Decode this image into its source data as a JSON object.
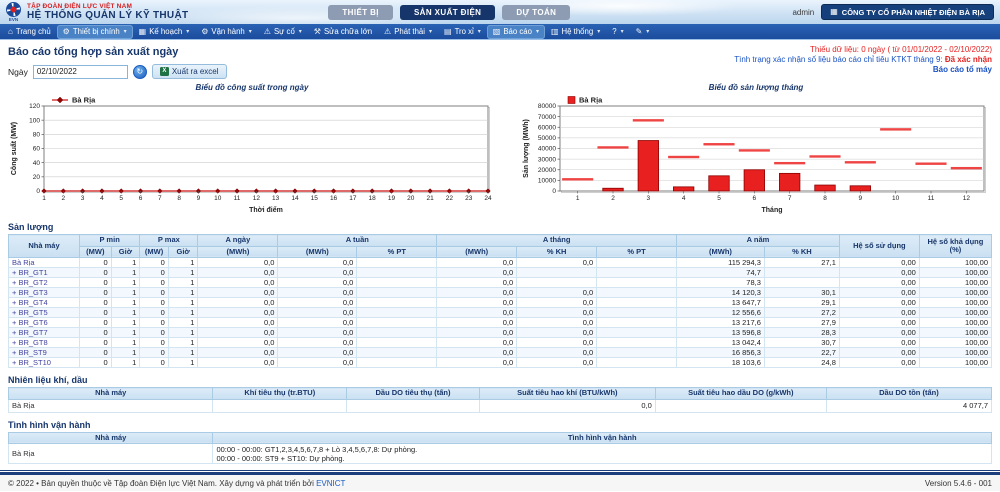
{
  "header": {
    "org": "TẬP ĐOÀN ĐIỆN LỰC VIỆT NAM",
    "system": "HỆ THỐNG QUẢN LÝ KỸ THUẬT",
    "logo_text": "EVN",
    "modules": [
      {
        "key": "thiet-bi",
        "label": "THIẾT BỊ",
        "active": false
      },
      {
        "key": "san-xuat-dien",
        "label": "SẢN XUẤT ĐIỆN",
        "active": true
      },
      {
        "key": "du-toan",
        "label": "DỰ TOÁN",
        "active": false
      }
    ],
    "user": "admin",
    "company_button": {
      "label": "CÔNG TY CỔ PHẦN NHIỆT ĐIỆN BÀ RỊA",
      "icon": "building-icon",
      "glyph": "▦"
    }
  },
  "nav": {
    "items": [
      {
        "key": "trang-chu",
        "label": "Trang chủ",
        "icon": "home-icon",
        "glyph": "⌂",
        "caret": false,
        "active": false
      },
      {
        "key": "thiet-bi-chinh",
        "label": "Thiết bị chính",
        "icon": "gear-icon",
        "glyph": "⚙",
        "caret": true,
        "active": true
      },
      {
        "key": "ke-hoach",
        "label": "Kế hoạch",
        "icon": "calendar-icon",
        "glyph": "▦",
        "caret": true,
        "active": false
      },
      {
        "key": "van-hanh",
        "label": "Vận hành",
        "icon": "gears-icon",
        "glyph": "⚙",
        "caret": true,
        "active": false
      },
      {
        "key": "su-co",
        "label": "Sự cố",
        "icon": "warning-icon",
        "glyph": "⚠",
        "caret": true,
        "active": false
      },
      {
        "key": "sua-chua-lon",
        "label": "Sửa chữa lớn",
        "icon": "wrench-icon",
        "glyph": "⚒",
        "caret": false,
        "active": false
      },
      {
        "key": "phat-thai",
        "label": "Phát thải",
        "icon": "warning-icon",
        "glyph": "⚠",
        "caret": true,
        "active": false
      },
      {
        "key": "tro-xi",
        "label": "Tro xỉ",
        "icon": "grid-icon",
        "glyph": "▤",
        "caret": true,
        "active": false
      },
      {
        "key": "bao-cao",
        "label": "Báo cáo",
        "icon": "chart-icon",
        "glyph": "▧",
        "caret": true,
        "active": true
      },
      {
        "key": "he-thong",
        "label": "Hệ thống",
        "icon": "list-icon",
        "glyph": "▥",
        "caret": true,
        "active": false
      },
      {
        "key": "help",
        "label": "?",
        "icon": "help-icon",
        "glyph": "",
        "caret": true,
        "active": false
      },
      {
        "key": "edit",
        "label": "",
        "icon": "pencil-icon",
        "glyph": "✎",
        "caret": true,
        "active": false
      }
    ]
  },
  "toolbar": {
    "page_title": "Báo cáo tổng hợp sản xuất ngày",
    "date_label": "Ngày",
    "date_value": "02/10/2022",
    "go_glyph": "↻",
    "export_label": "Xuất ra excel",
    "excel_glyph": "X",
    "missing_data": "Thiếu dữ liệu: 0 ngày ( từ 01/01/2022 - 02/10/2022)",
    "confirm_prefix": "Tình trạng xác nhận số liệu báo cáo chỉ tiêu KTKT tháng 9: ",
    "confirm_status": "Đã xác nhận",
    "unit_report_link": "Báo cáo tổ máy"
  },
  "chart_data": [
    {
      "type": "line",
      "title": "Biểu đồ công suất trong ngày",
      "xlabel": "Thời điểm",
      "ylabel": "Công suất (MW)",
      "x": [
        1,
        2,
        3,
        4,
        5,
        6,
        7,
        8,
        9,
        10,
        11,
        12,
        13,
        14,
        15,
        16,
        17,
        18,
        19,
        20,
        21,
        22,
        23,
        24
      ],
      "series": [
        {
          "name": "Bà Rịa",
          "values": [
            0,
            0,
            0,
            0,
            0,
            0,
            0,
            0,
            0,
            0,
            0,
            0,
            0,
            0,
            0,
            0,
            0,
            0,
            0,
            0,
            0,
            0,
            0,
            0
          ]
        }
      ],
      "ylim": [
        0,
        120
      ],
      "yticks": [
        0,
        20,
        40,
        60,
        80,
        100,
        120
      ],
      "grid": true,
      "legend_position": "top-left",
      "line_color": "#cc1111",
      "marker_color": "#990000"
    },
    {
      "type": "bar",
      "title": "Biểu đồ sản lượng tháng",
      "xlabel": "Tháng",
      "ylabel": "Sản lượng (MWh)",
      "categories": [
        1,
        2,
        3,
        4,
        5,
        6,
        7,
        8,
        9,
        10,
        11,
        12
      ],
      "series": [
        {
          "name": "Bà Rịa",
          "style": "bar",
          "values": [
            0,
            2600,
            47500,
            3900,
            14300,
            20000,
            16600,
            5600,
            4900,
            0,
            0,
            0
          ]
        },
        {
          "name": "",
          "style": "dash",
          "values": [
            11000,
            41000,
            66500,
            32000,
            44000,
            38200,
            26200,
            32500,
            27000,
            58000,
            25700,
            21500
          ]
        }
      ],
      "ylim": [
        0,
        80000
      ],
      "yticks": [
        0,
        10000,
        20000,
        30000,
        40000,
        50000,
        60000,
        70000,
        80000
      ],
      "grid": true,
      "legend_position": "top-left",
      "bar_color": "#e82020",
      "bar_border_color": "#8b0000",
      "dash_color": "#ef4444"
    }
  ],
  "production_table": {
    "title": "Sản lượng",
    "columns": [
      {
        "label": "Nhà máy",
        "subs": []
      },
      {
        "label": "P min",
        "subs": [
          "(MW)",
          "Giờ"
        ]
      },
      {
        "label": "P max",
        "subs": [
          "(MW)",
          "Giờ"
        ]
      },
      {
        "label": "A ngày",
        "subs": [
          "(MWh)"
        ]
      },
      {
        "label": "A tuần",
        "subs": [
          "(MWh)",
          "% PT"
        ]
      },
      {
        "label": "A tháng",
        "subs": [
          "(MWh)",
          "% KH",
          "% PT"
        ]
      },
      {
        "label": "A năm",
        "subs": [
          "(MWh)",
          "% KH"
        ]
      },
      {
        "label": "Hệ số sử dụng",
        "subs": []
      },
      {
        "label": "Hệ số khả dụng (%)",
        "subs": []
      }
    ],
    "rows": [
      [
        "Bà Rịa",
        "0",
        "1",
        "0",
        "1",
        "0,0",
        "0,0",
        "",
        "0,0",
        "0,0",
        "",
        "115 294,3",
        "27,1",
        "0,00",
        "100,00"
      ],
      [
        "+ BR_GT1",
        "0",
        "1",
        "0",
        "1",
        "0,0",
        "0,0",
        "",
        "0,0",
        "",
        "",
        "74,7",
        "",
        "0,00",
        "100,00"
      ],
      [
        "+ BR_GT2",
        "0",
        "1",
        "0",
        "1",
        "0,0",
        "0,0",
        "",
        "0,0",
        "",
        "",
        "78,3",
        "",
        "0,00",
        "100,00"
      ],
      [
        "+ BR_GT3",
        "0",
        "1",
        "0",
        "1",
        "0,0",
        "0,0",
        "",
        "0,0",
        "0,0",
        "",
        "14 120,3",
        "30,1",
        "0,00",
        "100,00"
      ],
      [
        "+ BR_GT4",
        "0",
        "1",
        "0",
        "1",
        "0,0",
        "0,0",
        "",
        "0,0",
        "0,0",
        "",
        "13 647,7",
        "29,1",
        "0,00",
        "100,00"
      ],
      [
        "+ BR_GT5",
        "0",
        "1",
        "0",
        "1",
        "0,0",
        "0,0",
        "",
        "0,0",
        "0,0",
        "",
        "12 556,6",
        "27,2",
        "0,00",
        "100,00"
      ],
      [
        "+ BR_GT6",
        "0",
        "1",
        "0",
        "1",
        "0,0",
        "0,0",
        "",
        "0,0",
        "0,0",
        "",
        "13 217,6",
        "27,9",
        "0,00",
        "100,00"
      ],
      [
        "+ BR_GT7",
        "0",
        "1",
        "0",
        "1",
        "0,0",
        "0,0",
        "",
        "0,0",
        "0,0",
        "",
        "13 596,8",
        "28,3",
        "0,00",
        "100,00"
      ],
      [
        "+ BR_GT8",
        "0",
        "1",
        "0",
        "1",
        "0,0",
        "0,0",
        "",
        "0,0",
        "0,0",
        "",
        "13 042,4",
        "30,7",
        "0,00",
        "100,00"
      ],
      [
        "+ BR_ST9",
        "0",
        "1",
        "0",
        "1",
        "0,0",
        "0,0",
        "",
        "0,0",
        "0,0",
        "",
        "16 856,3",
        "22,7",
        "0,00",
        "100,00"
      ],
      [
        "+ BR_ST10",
        "0",
        "1",
        "0",
        "1",
        "0,0",
        "0,0",
        "",
        "0,0",
        "0,0",
        "",
        "18 103,6",
        "24,8",
        "0,00",
        "100,00"
      ]
    ]
  },
  "fuel_table": {
    "title": "Nhiên liệu khí, dầu",
    "columns": [
      "Nhà máy",
      "Khí tiêu thụ (tr.BTU)",
      "Dầu DO tiêu thụ (tấn)",
      "Suất tiêu hao khí (BTU/kWh)",
      "Suất tiêu hao dầu DO (g/kWh)",
      "Dầu DO tồn (tấn)"
    ],
    "rows": [
      [
        "Bà Rịa",
        "",
        "",
        "0,0",
        "",
        "4 077,7"
      ]
    ]
  },
  "operation_table": {
    "title": "Tình hình vận hành",
    "columns": [
      "Nhà máy",
      "Tình hình vận hành"
    ],
    "rows": [
      {
        "plant": "Bà Rịa",
        "lines": [
          "00:00 - 00:00: GT1,2,3,4,5,6,7,8 + Lò 3,4,5,6,7,8: Dự phòng.",
          "00:00 - 00:00: ST9 + ST10: Dự phòng."
        ]
      }
    ]
  },
  "footer": {
    "copyright_prefix": "©  2022  •  Bản quyền thuộc về Tập đoàn Điện lực Việt Nam. Xây dựng và phát triển bởi ",
    "copyright_link": "EVNICT",
    "version": "Version 5.4.6 - 001"
  }
}
